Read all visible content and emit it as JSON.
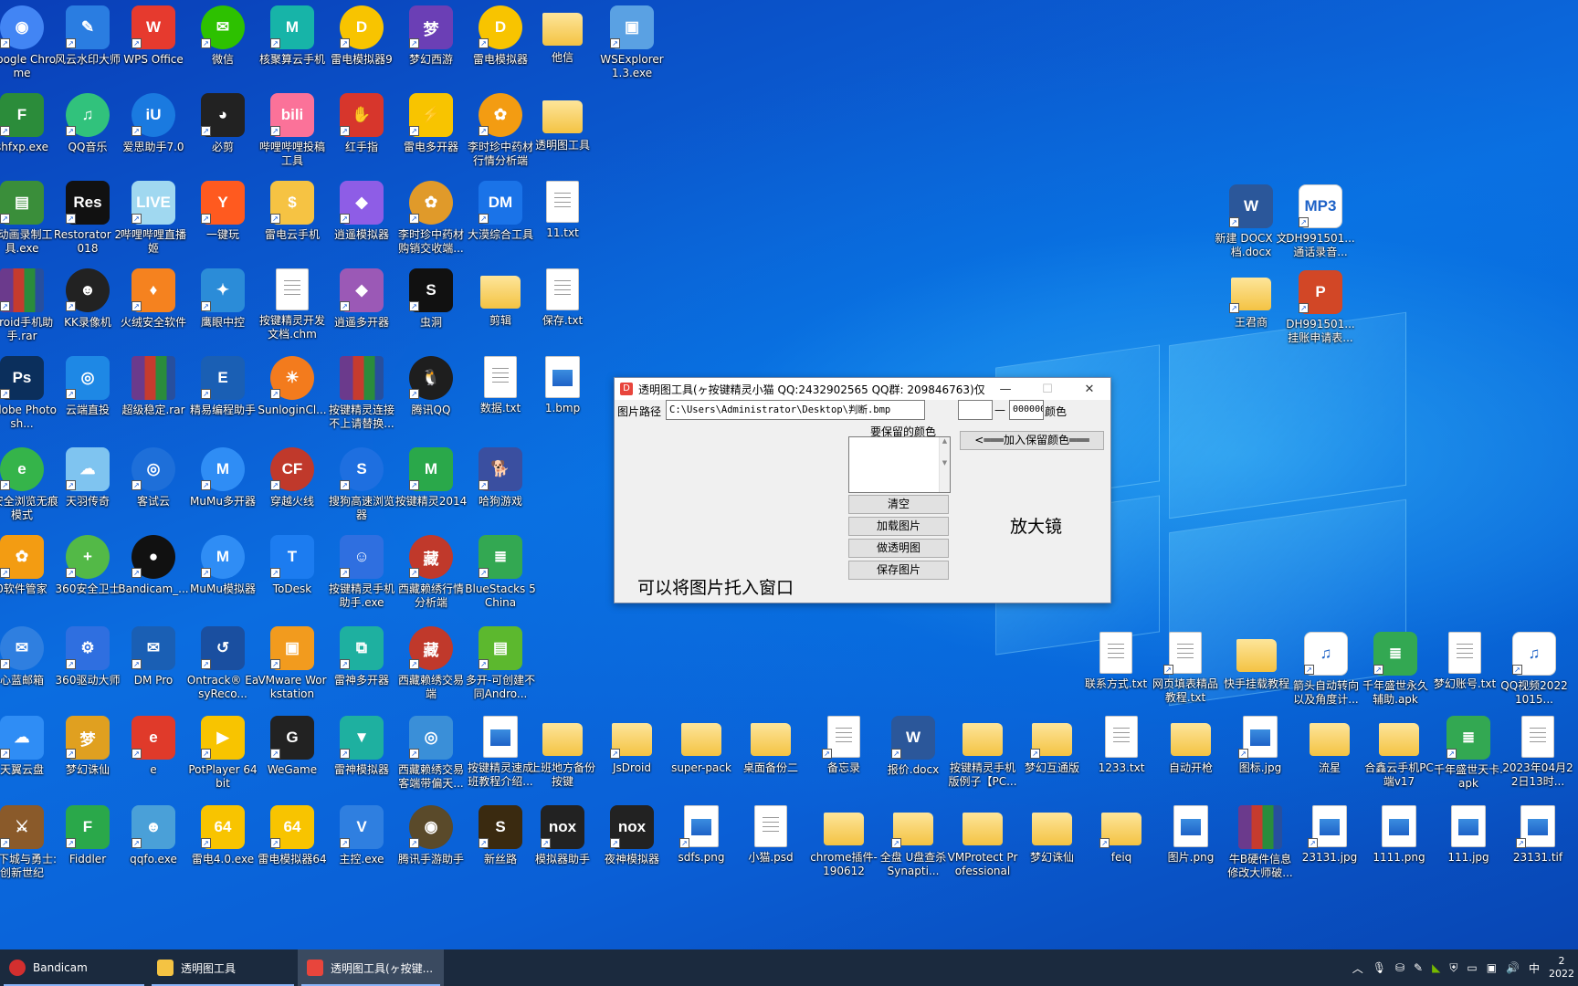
{
  "desktop_icons": [
    {
      "label": "Google Chrome",
      "kind": "circle",
      "color": "#4285f4",
      "glyph": "◉"
    },
    {
      "label": "风云水印大师",
      "kind": "app",
      "color": "#2a7de1",
      "glyph": "✎"
    },
    {
      "label": "WPS Office",
      "kind": "app",
      "color": "#e63a2e",
      "glyph": "W"
    },
    {
      "label": "微信",
      "kind": "circle",
      "color": "#2dc100",
      "glyph": "✉"
    },
    {
      "label": "核聚算云手机",
      "kind": "app",
      "color": "#17b4a8",
      "glyph": "M"
    },
    {
      "label": "雷电模拟器9",
      "kind": "circle",
      "color": "#f8c400",
      "glyph": "D"
    },
    {
      "label": "梦幻西游",
      "kind": "app",
      "color": "#6b3fb5",
      "glyph": "梦"
    },
    {
      "label": "雷电模拟器",
      "kind": "circle",
      "color": "#f8c400",
      "glyph": "D"
    },
    {
      "label": "他信",
      "kind": "folder"
    },
    {
      "label": "WSExplorer 1.3.exe",
      "kind": "app",
      "color": "#5aa1e3",
      "glyph": "▣"
    },
    {
      "label": "shfxp.exe",
      "kind": "app",
      "color": "#2b8c3a",
      "glyph": "F"
    },
    {
      "label": "QQ音乐",
      "kind": "circle",
      "color": "#31c27c",
      "glyph": "♫"
    },
    {
      "label": "爱思助手7.0",
      "kind": "circle",
      "color": "#1a7ae0",
      "glyph": "iU"
    },
    {
      "label": "必剪",
      "kind": "app",
      "color": "#222222",
      "glyph": "◕"
    },
    {
      "label": "哔哩哔哩投稿工具",
      "kind": "app",
      "color": "#fb7299",
      "glyph": "bili"
    },
    {
      "label": "红手指",
      "kind": "app",
      "color": "#d7362c",
      "glyph": "✋"
    },
    {
      "label": "雷电多开器",
      "kind": "app",
      "color": "#f8c400",
      "glyph": "⚡"
    },
    {
      "label": "李时珍中药材行情分析端",
      "kind": "circle",
      "color": "#f39c12",
      "glyph": "✿"
    },
    {
      "label": "透明图工具",
      "kind": "folder"
    },
    {
      "label": "F动画录制工具.exe",
      "kind": "app",
      "color": "#3a8e3a",
      "glyph": "▤"
    },
    {
      "label": "Restorator 2018",
      "kind": "app",
      "color": "#111111",
      "glyph": "Res"
    },
    {
      "label": "哔哩哔哩直播姬",
      "kind": "app",
      "color": "#a0d8f0",
      "glyph": "LIVE"
    },
    {
      "label": "一键玩",
      "kind": "app",
      "color": "#ff5a1f",
      "glyph": "Y"
    },
    {
      "label": "雷电云手机",
      "kind": "app",
      "color": "#f6c343",
      "glyph": "$"
    },
    {
      "label": "逍遥模拟器",
      "kind": "app",
      "color": "#8e5de6",
      "glyph": "◆"
    },
    {
      "label": "李时珍中药材购销交收端...",
      "kind": "circle",
      "color": "#e09a2a",
      "glyph": "✿"
    },
    {
      "label": "大漠综合工具",
      "kind": "app",
      "color": "#1a73e8",
      "glyph": "DM"
    },
    {
      "label": "11.txt",
      "kind": "doc"
    },
    {
      "label": "Droid手机助手.rar",
      "kind": "rar"
    },
    {
      "label": "KK录像机",
      "kind": "circle",
      "color": "#222222",
      "glyph": "☻"
    },
    {
      "label": "火绒安全软件",
      "kind": "app",
      "color": "#f5821f",
      "glyph": "♦"
    },
    {
      "label": "鹰眼中控",
      "kind": "app",
      "color": "#2b8cd8",
      "glyph": "✦"
    },
    {
      "label": "按键精灵开发文档.chm",
      "kind": "doc"
    },
    {
      "label": "逍遥多开器",
      "kind": "app",
      "color": "#9b59b6",
      "glyph": "◆"
    },
    {
      "label": "虫洞",
      "kind": "app",
      "color": "#111111",
      "glyph": "S"
    },
    {
      "label": "剪辑",
      "kind": "folder"
    },
    {
      "label": "保存.txt",
      "kind": "doc"
    },
    {
      "label": "Adobe Photosh...",
      "kind": "app",
      "color": "#0b2f5c",
      "glyph": "Ps"
    },
    {
      "label": "云端直投",
      "kind": "app",
      "color": "#1e88e5",
      "glyph": "◎"
    },
    {
      "label": "超级稳定.rar",
      "kind": "rar"
    },
    {
      "label": "精易编程助手",
      "kind": "app",
      "color": "#1a5fb4",
      "glyph": "E"
    },
    {
      "label": "SunloginCl...",
      "kind": "circle",
      "color": "#f37b1d",
      "glyph": "☀"
    },
    {
      "label": "按键精灵连接不上请替换...",
      "kind": "rar"
    },
    {
      "label": "腾讯QQ",
      "kind": "circle",
      "color": "#1e1e1e",
      "glyph": "🐧"
    },
    {
      "label": "数据.txt",
      "kind": "doc"
    },
    {
      "label": "1.bmp",
      "kind": "pic"
    },
    {
      "label": "0安全浏览无痕模式",
      "kind": "circle",
      "color": "#35b44a",
      "glyph": "e"
    },
    {
      "label": "天羽传奇",
      "kind": "app",
      "color": "#7fc4f0",
      "glyph": "☁"
    },
    {
      "label": "客试云",
      "kind": "circle",
      "color": "#1e6fd9",
      "glyph": "◎"
    },
    {
      "label": "MuMu多开器",
      "kind": "circle",
      "color": "#2f8df5",
      "glyph": "M"
    },
    {
      "label": "穿越火线",
      "kind": "circle",
      "color": "#c0392b",
      "glyph": "CF"
    },
    {
      "label": "搜狗高速浏览器",
      "kind": "circle",
      "color": "#1e6fe0",
      "glyph": "S"
    },
    {
      "label": "按键精灵2014",
      "kind": "app",
      "color": "#2aa84a",
      "glyph": "M"
    },
    {
      "label": "哈狗游戏",
      "kind": "app",
      "color": "#3a4fa0",
      "glyph": "🐕"
    },
    {
      "label": "0软件管家",
      "kind": "app",
      "color": "#f39c12",
      "glyph": "✿"
    },
    {
      "label": "360安全卫士",
      "kind": "circle",
      "color": "#53b947",
      "glyph": "+"
    },
    {
      "label": "Bandicam_...",
      "kind": "circle",
      "color": "#111111",
      "glyph": "●"
    },
    {
      "label": "MuMu模拟器",
      "kind": "circle",
      "color": "#2f8df5",
      "glyph": "M"
    },
    {
      "label": "ToDesk",
      "kind": "app",
      "color": "#1c7cf0",
      "glyph": "T"
    },
    {
      "label": "按键精灵手机助手.exe",
      "kind": "app",
      "color": "#2f6fe0",
      "glyph": "☺"
    },
    {
      "label": "西藏赖绣行情分析端",
      "kind": "circle",
      "color": "#c0392b",
      "glyph": "藏"
    },
    {
      "label": "BlueStacks 5 China",
      "kind": "app",
      "color": "#33a852",
      "glyph": "≣"
    },
    {
      "label": "心蓝邮箱",
      "kind": "circle",
      "color": "#2f7fe0",
      "glyph": "✉"
    },
    {
      "label": "360驱动大师",
      "kind": "app",
      "color": "#2f6fe0",
      "glyph": "⚙"
    },
    {
      "label": "DM Pro",
      "kind": "app",
      "color": "#1a5fb4",
      "glyph": "✉"
    },
    {
      "label": "Ontrack® EasyReco...",
      "kind": "app",
      "color": "#1a4fa0",
      "glyph": "↺"
    },
    {
      "label": "VMware Workstation",
      "kind": "app",
      "color": "#f29b1e",
      "glyph": "▣"
    },
    {
      "label": "雷神多开器",
      "kind": "app",
      "color": "#1eb0a0",
      "glyph": "⧉"
    },
    {
      "label": "西藏赖绣交易端",
      "kind": "circle",
      "color": "#c0392b",
      "glyph": "藏"
    },
    {
      "label": "多开-可创建不同Andro...",
      "kind": "app",
      "color": "#5cb82e",
      "glyph": "▤"
    },
    {
      "label": "天翼云盘",
      "kind": "app",
      "color": "#2f8df5",
      "glyph": "☁"
    },
    {
      "label": "梦幻诛仙",
      "kind": "app",
      "color": "#e0a020",
      "glyph": "梦"
    },
    {
      "label": "e",
      "kind": "app",
      "color": "#e03a2a",
      "glyph": "e"
    },
    {
      "label": "PotPlayer 64 bit",
      "kind": "app",
      "color": "#f8c400",
      "glyph": "▶"
    },
    {
      "label": "WeGame",
      "kind": "app",
      "color": "#222222",
      "glyph": "G"
    },
    {
      "label": "雷神模拟器",
      "kind": "app",
      "color": "#1eb0a0",
      "glyph": "▼"
    },
    {
      "label": "西藏赖绣交易客端带偏天...",
      "kind": "app",
      "color": "#3a8fd8",
      "glyph": "◎"
    },
    {
      "label": "按键精灵速成班教程介绍...",
      "kind": "pic"
    },
    {
      "label": "上班地方备份按键",
      "kind": "folder"
    },
    {
      "label": "JsDroid",
      "kind": "folder"
    },
    {
      "label": "super-pack",
      "kind": "folder"
    },
    {
      "label": "桌面备份二",
      "kind": "folder"
    },
    {
      "label": "备忘录",
      "kind": "doc"
    },
    {
      "label": "报价.docx",
      "kind": "app",
      "color": "#2b579a",
      "glyph": "W"
    },
    {
      "label": "按键精灵手机版例子【PC...",
      "kind": "folder"
    },
    {
      "label": "梦幻互通版",
      "kind": "folder"
    },
    {
      "label": "1233.txt",
      "kind": "doc"
    },
    {
      "label": "自动开枪",
      "kind": "folder"
    },
    {
      "label": "图标.jpg",
      "kind": "pic"
    },
    {
      "label": "流星",
      "kind": "folder"
    },
    {
      "label": "合鑫云手机PC端v17",
      "kind": "folder"
    },
    {
      "label": "千年盛世天卡.apk",
      "kind": "app",
      "color": "#33a852",
      "glyph": "≣"
    },
    {
      "label": "2023年04月22日13时...",
      "kind": "doc"
    },
    {
      "label": "飞下城与勇士:创新世纪",
      "kind": "app",
      "color": "#8a5a2a",
      "glyph": "⚔"
    },
    {
      "label": "Fiddler",
      "kind": "app",
      "color": "#2aa84a",
      "glyph": "F"
    },
    {
      "label": "qqfo.exe",
      "kind": "app",
      "color": "#4aa0d8",
      "glyph": "☻"
    },
    {
      "label": "雷电4.0.exe",
      "kind": "app",
      "color": "#f8c400",
      "glyph": "64"
    },
    {
      "label": "雷电模拟器64",
      "kind": "app",
      "color": "#f8c400",
      "glyph": "64"
    },
    {
      "label": "主控.exe",
      "kind": "app",
      "color": "#2f7fe0",
      "glyph": "V"
    },
    {
      "label": "腾讯手游助手",
      "kind": "circle",
      "color": "#5a4a2a",
      "glyph": "◉"
    },
    {
      "label": "新丝路",
      "kind": "app",
      "color": "#3a2a10",
      "glyph": "S"
    },
    {
      "label": "模拟器助手",
      "kind": "app",
      "color": "#222222",
      "glyph": "nox"
    },
    {
      "label": "夜神模拟器",
      "kind": "app",
      "color": "#222222",
      "glyph": "nox"
    },
    {
      "label": "sdfs.png",
      "kind": "pic"
    },
    {
      "label": "小猫.psd",
      "kind": "doc"
    },
    {
      "label": "chrome插件-190612",
      "kind": "folder"
    },
    {
      "label": "全盘 U盘查杀Synapti...",
      "kind": "folder"
    },
    {
      "label": "VMProtect Professional",
      "kind": "folder"
    },
    {
      "label": "梦幻诛仙",
      "kind": "folder"
    },
    {
      "label": "feiq",
      "kind": "folder"
    },
    {
      "label": "图片.png",
      "kind": "pic"
    },
    {
      "label": "牛B硬件信息修改大师破...",
      "kind": "rar"
    },
    {
      "label": "23131.jpg",
      "kind": "pic"
    },
    {
      "label": "1111.png",
      "kind": "pic"
    },
    {
      "label": "111.jpg",
      "kind": "pic"
    },
    {
      "label": "23131.tif",
      "kind": "pic"
    },
    {
      "label": "新建 DOCX 文档.docx",
      "kind": "app",
      "color": "#2b579a",
      "glyph": "W"
    },
    {
      "label": "DH991501...通话录音...",
      "kind": "app",
      "color": "#ffffff",
      "glyph": "MP3"
    },
    {
      "label": "王君商",
      "kind": "folder"
    },
    {
      "label": "DH991501...挂账申请表...",
      "kind": "app",
      "color": "#d24726",
      "glyph": "P"
    },
    {
      "label": "联系方式.txt",
      "kind": "doc"
    },
    {
      "label": "网页填表精品教程.txt",
      "kind": "doc"
    },
    {
      "label": "快手挂载教程",
      "kind": "folder"
    },
    {
      "label": "箭头自动转向以及角度计...",
      "kind": "app",
      "color": "#ffffff",
      "glyph": "♫"
    },
    {
      "label": "千年盛世永久辅助.apk",
      "kind": "app",
      "color": "#33a852",
      "glyph": "≣"
    },
    {
      "label": "梦幻账号.txt",
      "kind": "doc"
    },
    {
      "label": "QQ视频20221015...",
      "kind": "app",
      "color": "#ffffff",
      "glyph": "♫"
    }
  ],
  "dialog": {
    "title": "透明图工具(ヶ按键精灵小猫 QQ:2432902565 QQ群: 209846763)仅...",
    "path_label": "图片路径",
    "path_value": "C:\\Users\\Administrator\\Desktop\\判断.bmp",
    "dash": "—",
    "color_value": "000000",
    "color_label": "颜色",
    "keep_color_label": "要保留的颜色",
    "add_keep_button": "<═══加入保留颜色═══",
    "clear_button": "清空",
    "load_button": "加载图片",
    "make_transparent_button": "做透明图",
    "save_button": "保存图片",
    "magnifier_label": "放大镜",
    "drop_hint": "可以将图片托入窗口"
  },
  "taskbar": {
    "items": [
      {
        "label": "Bandicam",
        "color": "#d32f2f"
      },
      {
        "label": "透明图工具",
        "color": "#f4c343"
      },
      {
        "label": "透明图工具(ヶ按键...",
        "color": "#e8453c"
      }
    ],
    "tray_ime": "中",
    "clock_top": "2",
    "clock_bottom": "2022"
  }
}
